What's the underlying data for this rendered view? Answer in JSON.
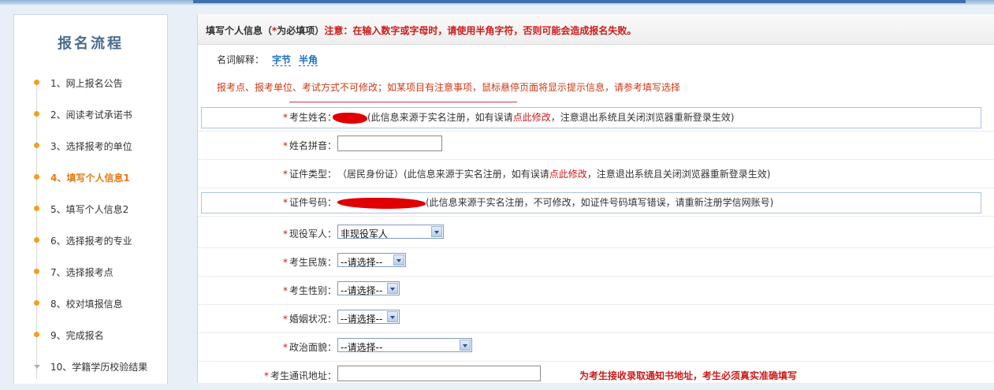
{
  "sidebar": {
    "title": "报名流程",
    "steps": [
      "1、网上报名公告",
      "2、阅读考试承诺书",
      "3、选择报考的单位",
      "4、填写个人信息1",
      "5、填写个人信息2",
      "6、选择报考的专业",
      "7、选择报考点",
      "8、校对填报信息",
      "9、完成报名",
      "10、学籍学历校验结果"
    ],
    "active_index": 3
  },
  "header": {
    "prefix": "填写个人信息（",
    "star": "*",
    "middle": "为必填项）",
    "warning": "注意：在输入数字或字母时，请使用半角字符，否则可能会造成报名失败。"
  },
  "terms": {
    "label": "名词解释：",
    "link1": "字节",
    "link2": "半角"
  },
  "notice": "报考点、报考单位、考试方式不可修改；如某项目有注意事项，鼠标悬停页面将显示提示信息，请参考填写选择",
  "form": {
    "name": {
      "star": "*",
      "label": "考生姓名：",
      "note_pre": "(此信息来源于实名注册，如有误请",
      "link": "点此修改",
      "note_post": "，注意退出系统且关闭浏览器重新登录生效)"
    },
    "pinyin": {
      "star": "*",
      "label": "姓名拼音：",
      "value": ""
    },
    "id_type": {
      "star": "*",
      "label": "证件类型：",
      "value": "（居民身份证）",
      "note_pre": "(此信息来源于实名注册，如有误请",
      "link": "点此修改",
      "note_post": "，注意退出系统且关闭浏览器重新登录生效)"
    },
    "id_number": {
      "star": "*",
      "label": "证件号码：",
      "note": "(此信息来源于实名注册，不可修改，如证件号码填写错误，请重新注册学信网账号)"
    },
    "military": {
      "star": "*",
      "label": "现役军人：",
      "value": "非现役军人"
    },
    "ethnicity": {
      "star": "*",
      "label": "考生民族：",
      "value": "--请选择--"
    },
    "gender": {
      "star": "*",
      "label": "考生性别：",
      "value": "--请选择--"
    },
    "marital": {
      "star": "*",
      "label": "婚姻状况：",
      "value": "--请选择--"
    },
    "political": {
      "star": "*",
      "label": "政治面貌：",
      "value": "--请选择--"
    },
    "address": {
      "star": "*",
      "label": "考生通讯地址：",
      "value": "",
      "hint": "为考生接收录取通知书地址，考生必须真实准确填写"
    }
  },
  "colors": {
    "accent_red": "#cc1b1b",
    "active_step": "#e87a14",
    "link_blue": "#1c6fc4",
    "redaction": "#e00000"
  }
}
